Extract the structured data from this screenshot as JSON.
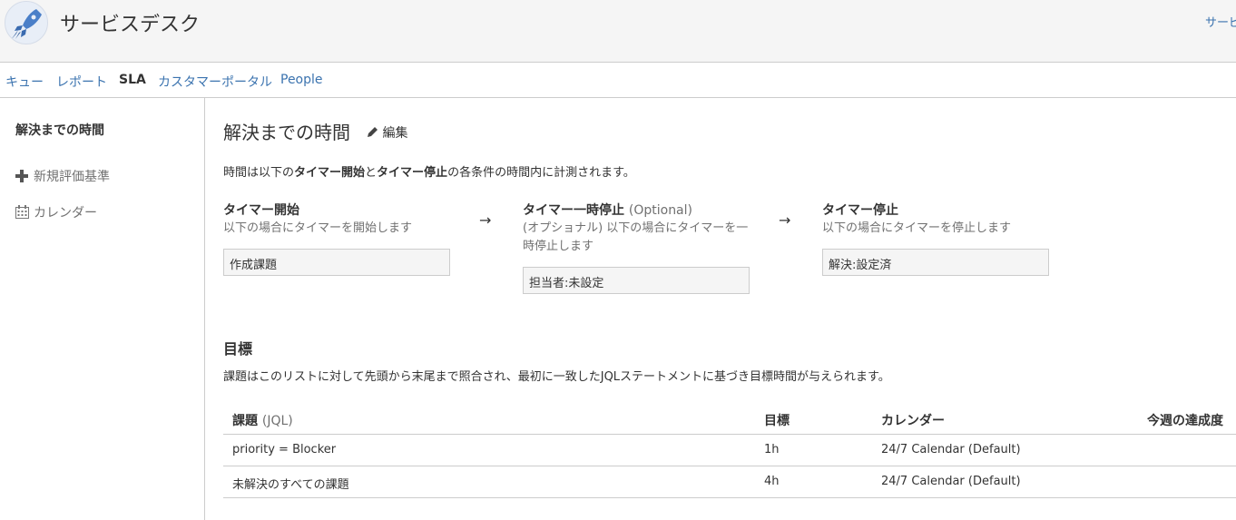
{
  "header": {
    "title": "サービスデスク",
    "right_link": "サービ"
  },
  "tabs": [
    {
      "label": "キュー"
    },
    {
      "label": "レポート"
    },
    {
      "label": "SLA"
    },
    {
      "label": "カスタマーポータル"
    },
    {
      "label": "People"
    }
  ],
  "sidebar": {
    "title": "解決までの時間",
    "items": [
      {
        "label": "新規評価基準",
        "icon": "plus-icon"
      },
      {
        "label": "カレンダー",
        "icon": "calendar-icon"
      }
    ]
  },
  "main": {
    "title": "解決までの時間",
    "edit_label": "編集",
    "intro": {
      "part1": "時間は以下の",
      "bold1": "タイマー開始",
      "part2": "と",
      "bold2": "タイマー停止",
      "part3": "の各条件の時間内に計測されます。"
    },
    "timer": {
      "start": {
        "title": "タイマー開始",
        "desc": "以下の場合にタイマーを開始します",
        "value": "作成課題"
      },
      "pause": {
        "title": "タイマー一時停止",
        "optional": "(Optional)",
        "desc": "(オプショナル) 以下の場合にタイマーを一時停止します",
        "value": "担当者:未設定"
      },
      "stop": {
        "title": "タイマー停止",
        "desc": "以下の場合にタイマーを停止します",
        "value": "解決:設定済"
      }
    },
    "arrow": "→",
    "goals": {
      "title": "目標",
      "desc": "課題はこのリストに対して先頭から末尾まで照合され、最初に一致したJQLステートメントに基づき目標時間が与えられます。",
      "headers": {
        "issue": "課題",
        "issue_muted": "(JQL)",
        "goal": "目標",
        "calendar": "カレンダー",
        "weekly": "今週の達成度"
      },
      "rows": [
        {
          "jql": "priority = Blocker",
          "goal": "1h",
          "calendar": "24/7 Calendar (Default)"
        },
        {
          "jql": "未解決のすべての課題",
          "goal": "4h",
          "calendar": "24/7 Calendar (Default)"
        }
      ]
    }
  },
  "colors": {
    "link": "#3b73af",
    "text": "#333333",
    "muted": "#707070",
    "border": "#cccccc",
    "header_bg": "#f5f5f5"
  }
}
